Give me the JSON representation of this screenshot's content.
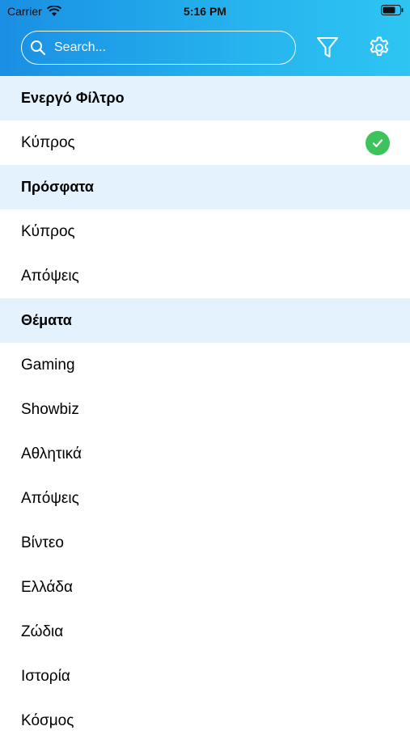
{
  "status": {
    "carrier": "Carrier",
    "time": "5:16 PM"
  },
  "search": {
    "placeholder": "Search..."
  },
  "icons": {
    "search": "search-icon",
    "filter": "filter-icon",
    "settings": "gear-icon",
    "selected": "checkmark-circle-icon"
  },
  "colors": {
    "header_start": "#1a8fe3",
    "header_end": "#2ec5f2",
    "section_bg": "#e3f2fd",
    "check_green": "#3cc45a"
  },
  "sections": {
    "active": {
      "title": "Ενεργό Φίλτρο",
      "items": [
        {
          "label": "Κύπρος",
          "selected": true
        }
      ]
    },
    "recent": {
      "title": "Πρόσφατα",
      "items": [
        "Κύπρος",
        "Απόψεις"
      ]
    },
    "topics": {
      "title": "Θέματα",
      "items": [
        "Gaming",
        "Showbiz",
        "Αθλητικά",
        "Απόψεις",
        "Βίντεο",
        "Ελλάδα",
        "Ζώδια",
        "Ιστορία",
        "Κόσμος"
      ]
    }
  }
}
